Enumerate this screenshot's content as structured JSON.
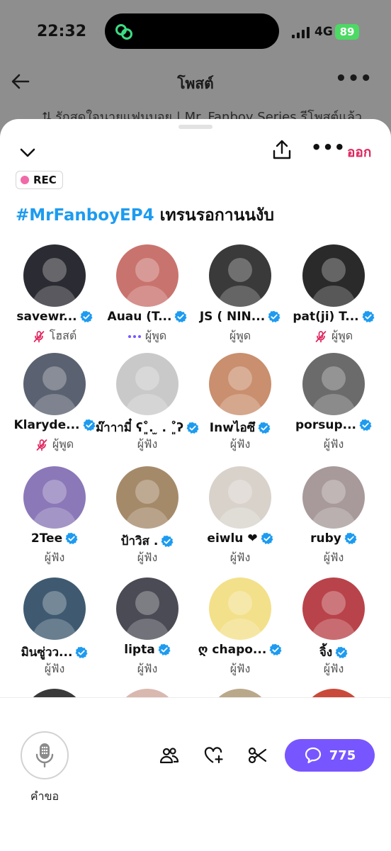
{
  "status_bar": {
    "time": "22:32",
    "network": "4G",
    "battery": "89"
  },
  "header": {
    "title": "โพสต์",
    "repost_line": "รักสุดใจนายแฟนบอย | Mr. Fanboy Series รีโพสต์แล้ว"
  },
  "sheet": {
    "leave_label": "ออก",
    "rec_label": "REC",
    "hashtag": "#MrFanboyEP4",
    "title_rest": " เทรนรอกานนงับ"
  },
  "participants": [
    {
      "name": "savewr...",
      "role": "โฮสต์",
      "role_icon": "mic-off-icon",
      "color": "#2b2b33"
    },
    {
      "name": "Auau (T...",
      "role": "ผู้พูด",
      "role_icon": "speaking-dots-icon",
      "color": "#c9736e"
    },
    {
      "name": "JS ( NIN...",
      "role": "ผู้พูด",
      "role_icon": "",
      "color": "#3a3a3a"
    },
    {
      "name": "pat(ji) T...",
      "role": "ผู้พูด",
      "role_icon": "mic-off-icon",
      "color": "#2a2a2a"
    },
    {
      "name": "Klaryde...",
      "role": "ผู้พูด",
      "role_icon": "mic-off-icon",
      "color": "#5a6170"
    },
    {
      "name": "ม๊าาามี๋ ʕ˚͈̀. ̫ . ˚͈́ʔ",
      "role": "ผู้ฟัง",
      "role_icon": "",
      "color": "#c9c9c9"
    },
    {
      "name": "Inwไอซึ",
      "role": "ผู้ฟัง",
      "role_icon": "",
      "color": "#c98f6e"
    },
    {
      "name": "porsup...",
      "role": "ผู้ฟัง",
      "role_icon": "",
      "color": "#6b6b6b"
    },
    {
      "name": "2Tee",
      "role": "ผู้ฟัง",
      "role_icon": "",
      "color": "#8b78b8"
    },
    {
      "name": "ป้าวิส .",
      "role": "ผู้ฟัง",
      "role_icon": "",
      "color": "#a58a6a"
    },
    {
      "name": "eiwlu ❤",
      "role": "ผู้ฟัง",
      "role_icon": "",
      "color": "#d8d2cb"
    },
    {
      "name": "ruby",
      "role": "ผู้ฟัง",
      "role_icon": "",
      "color": "#a89a9a"
    },
    {
      "name": "มินซู่วว...",
      "role": "ผู้ฟัง",
      "role_icon": "",
      "color": "#3f5a70"
    },
    {
      "name": "lipta",
      "role": "ผู้ฟัง",
      "role_icon": "",
      "color": "#4b4b55"
    },
    {
      "name": "ღ chapo...",
      "role": "ผู้ฟัง",
      "role_icon": "",
      "color": "#f3e08a"
    },
    {
      "name": "จิ้ง",
      "role": "ผู้ฟัง",
      "role_icon": "",
      "color": "#b9434a"
    }
  ],
  "more_avatar_colors": [
    "#3a3a3a",
    "#d9b8b0",
    "#b9a88a",
    "#c94a3a"
  ],
  "bottom_bar": {
    "request_label": "คำขอ",
    "comments_count": "775",
    "accent": "#7856ff"
  },
  "colors": {
    "verified": "#1d9bf0",
    "leave": "#e0245e",
    "mute": "#e0245e",
    "rec_dot": "#f06aa8"
  }
}
